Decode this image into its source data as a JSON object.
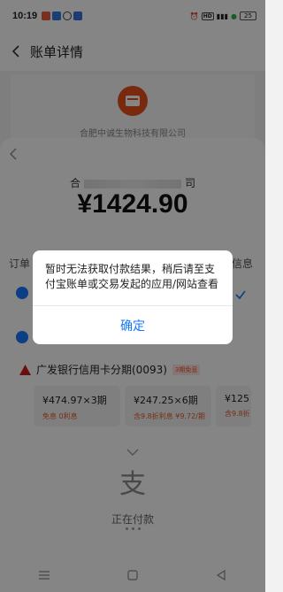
{
  "status_bar": {
    "time": "10:19",
    "battery": "25",
    "network": "HD"
  },
  "header": {
    "title": "账单详情"
  },
  "merchant": {
    "name": "合肥中诚生物科技有限公司"
  },
  "sheet": {
    "payee_prefix": "合",
    "payee_suffix": "司",
    "amount": "¥1424.90",
    "side_label_left": "订单",
    "side_label_right": "信息",
    "bank": {
      "name": "广发银行信用卡分期(0093)",
      "badge": "3期免息",
      "plans": [
        {
          "main": "¥474.97×3期",
          "sub": "免息 0利息"
        },
        {
          "main": "¥247.25×6期",
          "sub": "含9.8折利息 ¥9.72/期"
        },
        {
          "main": "¥125",
          "sub": "含9.8折"
        }
      ]
    },
    "paying_text": "正在付款"
  },
  "dialog": {
    "message": "暂时无法获取付款结果，稍后请至支付宝账单或交易发起的应用/网站查看",
    "confirm_label": "确定"
  },
  "colors": {
    "accent": "#1677ff",
    "brand": "#e8501c",
    "overlay": "rgba(0,0,0,0.48)"
  },
  "icons": [
    "back-icon",
    "merchant-logo-icon",
    "radio-icon",
    "check-icon",
    "bank-warning-icon",
    "chevron-down-icon",
    "alipay-icon",
    "nav-menu-icon",
    "nav-home-icon",
    "nav-back-icon"
  ]
}
